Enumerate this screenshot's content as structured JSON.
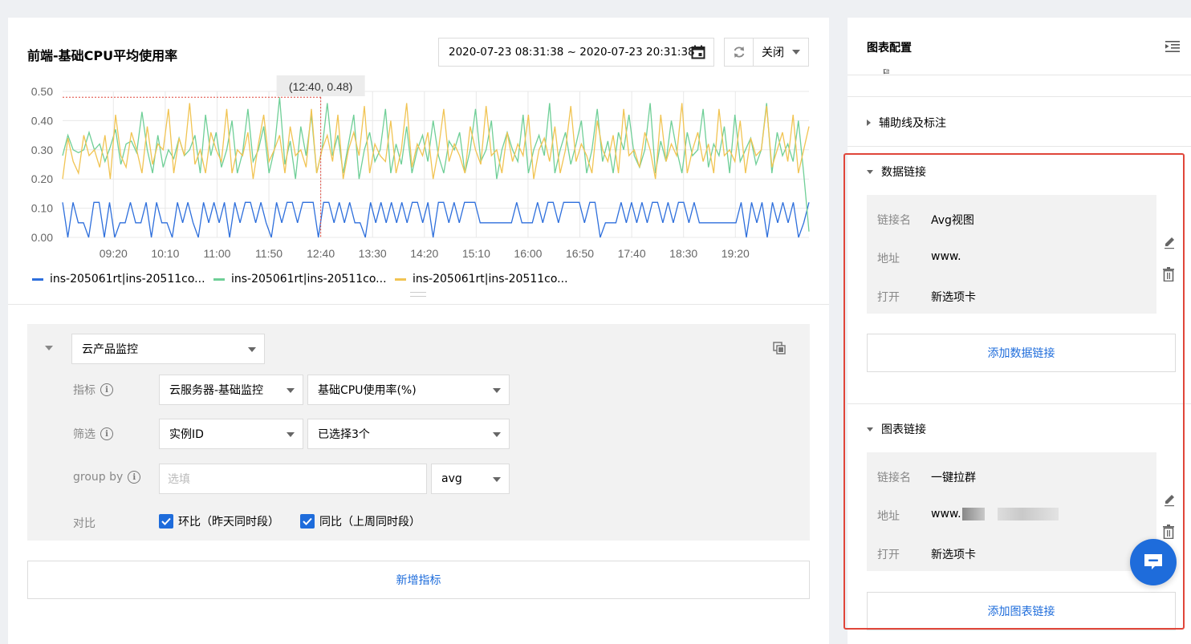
{
  "chart_panel": {
    "title": "前端-基础CPU平均使用率",
    "time_range": "2020-07-23 08:31:38 ~ 2020-07-23 20:31:38",
    "refresh_select": "关闭",
    "tooltip": "(12:40, 0.48)",
    "legend": [
      {
        "label": "ins-205061rt|ins-20511co...",
        "color": "#2e6fdc"
      },
      {
        "label": "ins-205061rt|ins-20511co...",
        "color": "#6fcf97"
      },
      {
        "label": "ins-205061rt|ins-20511co...",
        "color": "#f1c453"
      }
    ]
  },
  "chart_data": {
    "type": "line",
    "title": "前端-基础CPU平均使用率",
    "x_ticks": [
      "09:20",
      "10:10",
      "11:00",
      "11:50",
      "12:40",
      "13:30",
      "14:20",
      "15:10",
      "16:00",
      "16:50",
      "17:40",
      "18:30",
      "19:20"
    ],
    "y_ticks": [
      "0.00",
      "0.10",
      "0.20",
      "0.30",
      "0.40",
      "0.50"
    ],
    "ylim": [
      0,
      0.5
    ],
    "xlim_minutes": [
      511,
      1231
    ],
    "grid": true,
    "legend_position": "bottom-left",
    "highlight": {
      "x": "12:40",
      "y": 0.48
    },
    "series": [
      {
        "name": "ins-205061rt|ins-20511co...",
        "color": "#2e6fdc",
        "values": [
          0.12,
          0.0,
          0.12,
          0.05,
          0.05,
          0.0,
          0.12,
          0.12,
          0.0,
          0.12,
          0.0,
          0.05,
          0.05,
          0.12,
          0.05,
          0.05,
          0.12,
          0.0,
          0.12,
          0.05,
          0.05,
          0.0,
          0.12,
          0.05,
          0.12,
          0.05,
          0.0,
          0.12,
          0.05,
          0.12,
          0.05,
          0.12,
          0.0,
          0.12,
          0.05,
          0.12,
          0.12,
          0.05,
          0.12,
          0.05,
          0.0,
          0.12,
          0.05,
          0.12,
          0.12,
          0.05,
          0.12,
          0.12,
          0.12,
          0.0,
          0.12,
          0.12,
          0.05,
          0.12,
          0.05,
          0.12,
          0.05,
          0.05,
          0.0,
          0.12,
          0.05,
          0.12,
          0.05,
          0.12,
          0.05,
          0.12,
          0.05,
          0.12,
          0.12,
          0.05,
          0.12,
          0.0,
          0.12,
          0.12,
          0.05,
          0.12,
          0.05,
          0.12,
          0.12,
          0.12,
          0.05,
          0.05,
          0.05,
          0.05,
          0.05,
          0.05,
          0.05,
          0.12,
          0.05,
          0.05,
          0.05,
          0.12,
          0.05,
          0.12,
          0.12,
          0.05,
          0.12,
          0.12,
          0.12,
          0.12,
          0.05,
          0.12,
          0.12,
          0.0,
          0.05,
          0.05,
          0.05,
          0.12,
          0.05,
          0.12,
          0.05,
          0.12,
          0.05,
          0.12,
          0.12,
          0.05,
          0.12,
          0.05,
          0.12,
          0.12,
          0.05,
          0.12,
          0.05,
          0.05,
          0.05,
          0.05,
          0.05,
          0.05,
          0.05,
          0.05,
          0.12,
          0.0,
          0.12,
          0.05,
          0.12,
          0.0,
          0.12,
          0.05,
          0.12,
          0.05,
          0.12,
          0.0,
          0.05,
          0.12
        ],
        "_len_note": ""
      },
      {
        "name": "ins-205061rt|ins-20511co...",
        "color": "#6fcf97",
        "values": [
          0.28,
          0.35,
          0.3,
          0.29,
          0.3,
          0.36,
          0.3,
          0.32,
          0.26,
          0.31,
          0.37,
          0.25,
          0.32,
          0.33,
          0.29,
          0.43,
          0.3,
          0.22,
          0.35,
          0.24,
          0.3,
          0.27,
          0.34,
          0.28,
          0.3,
          0.35,
          0.22,
          0.42,
          0.28,
          0.36,
          0.24,
          0.3,
          0.4,
          0.22,
          0.29,
          0.44,
          0.26,
          0.3,
          0.38,
          0.22,
          0.3,
          0.48,
          0.25,
          0.33,
          0.2,
          0.38,
          0.28,
          0.42,
          0.22,
          0.3,
          0.46,
          0.28,
          0.35,
          0.22,
          0.32,
          0.42,
          0.2,
          0.3,
          0.36,
          0.26,
          0.3,
          0.44,
          0.22,
          0.32,
          0.25,
          0.38,
          0.22,
          0.3,
          0.35,
          0.26,
          0.4,
          0.28,
          0.22,
          0.33,
          0.3,
          0.36,
          0.22,
          0.3,
          0.44,
          0.26,
          0.3,
          0.4,
          0.2,
          0.3,
          0.36,
          0.3,
          0.26,
          0.42,
          0.22,
          0.3,
          0.35,
          0.28,
          0.46,
          0.22,
          0.3,
          0.36,
          0.25,
          0.32,
          0.4,
          0.22,
          0.3,
          0.44,
          0.26,
          0.33,
          0.22,
          0.36,
          0.3,
          0.42,
          0.28,
          0.24,
          0.3,
          0.46,
          0.22,
          0.33,
          0.26,
          0.4,
          0.3,
          0.22,
          0.36,
          0.28,
          0.3,
          0.44,
          0.24,
          0.32,
          0.28,
          0.38,
          0.22,
          0.42,
          0.26,
          0.3,
          0.34,
          0.25,
          0.3,
          0.46,
          0.22,
          0.36,
          0.28,
          0.32,
          0.26,
          0.4,
          0.22,
          0.02
        ]
      },
      {
        "name": "ins-205061rt|ins-20511co...",
        "color": "#f1c453",
        "values": [
          0.2,
          0.34,
          0.26,
          0.22,
          0.35,
          0.28,
          0.3,
          0.24,
          0.35,
          0.2,
          0.42,
          0.28,
          0.24,
          0.36,
          0.3,
          0.22,
          0.38,
          0.25,
          0.32,
          0.3,
          0.44,
          0.22,
          0.34,
          0.28,
          0.46,
          0.25,
          0.3,
          0.22,
          0.36,
          0.3,
          0.26,
          0.44,
          0.22,
          0.3,
          0.28,
          0.36,
          0.2,
          0.32,
          0.42,
          0.26,
          0.3,
          0.35,
          0.22,
          0.38,
          0.28,
          0.3,
          0.24,
          0.44,
          0.22,
          0.3,
          0.35,
          0.26,
          0.42,
          0.2,
          0.3,
          0.36,
          0.28,
          0.45,
          0.22,
          0.32,
          0.28,
          0.26,
          0.4,
          0.22,
          0.3,
          0.46,
          0.24,
          0.32,
          0.28,
          0.36,
          0.2,
          0.3,
          0.44,
          0.26,
          0.32,
          0.28,
          0.22,
          0.38,
          0.3,
          0.25,
          0.45,
          0.28,
          0.3,
          0.22,
          0.36,
          0.26,
          0.32,
          0.28,
          0.42,
          0.2,
          0.3,
          0.34,
          0.26,
          0.38,
          0.22,
          0.3,
          0.45,
          0.26,
          0.32,
          0.28,
          0.22,
          0.4,
          0.3,
          0.26,
          0.35,
          0.22,
          0.44,
          0.28,
          0.3,
          0.24,
          0.36,
          0.3,
          0.2,
          0.42,
          0.26,
          0.32,
          0.28,
          0.46,
          0.22,
          0.3,
          0.36,
          0.26,
          0.32,
          0.22,
          0.44,
          0.28,
          0.3,
          0.26,
          0.4,
          0.22,
          0.34,
          0.28,
          0.3,
          0.45,
          0.24,
          0.3,
          0.36,
          0.26,
          0.42,
          0.22,
          0.3,
          0.38
        ]
      }
    ]
  },
  "query": {
    "source_select": "云产品监控",
    "metric_label": "指标",
    "metric_ns": "云服务器-基础监控",
    "metric_name": "基础CPU使用率(%)",
    "filter_label": "筛选",
    "filter_key": "实例ID",
    "filter_value": "已选择3个",
    "groupby_label": "group by",
    "groupby_placeholder": "选填",
    "agg": "avg",
    "compare_label": "对比",
    "compare_1": "环比（昨天同时段）",
    "compare_2": "同比（上周同时段）",
    "add_metric": "新增指标"
  },
  "side": {
    "title": "图表配置",
    "partial_section": "图例",
    "aux_section": "辅助线及标注",
    "data_link": {
      "title": "数据链接",
      "name_key": "链接名",
      "name_val": "Avg视图",
      "url_key": "地址",
      "url_val": "www.",
      "open_key": "打开",
      "open_val": "新选项卡",
      "add_btn": "添加数据链接"
    },
    "chart_link": {
      "title": "图表链接",
      "name_key": "链接名",
      "name_val": "一键拉群",
      "url_key": "地址",
      "url_val": "www.",
      "open_key": "打开",
      "open_val": "新选项卡",
      "add_btn": "添加图表链接"
    }
  }
}
